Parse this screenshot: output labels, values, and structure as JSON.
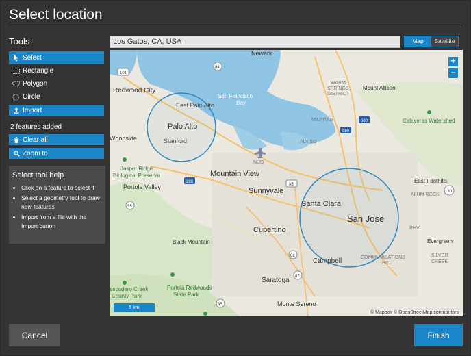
{
  "dialog": {
    "title": "Select location"
  },
  "tools": {
    "heading": "Tools",
    "items": [
      {
        "label": "Select",
        "icon": "cursor-icon",
        "active": true
      },
      {
        "label": "Rectangle",
        "icon": "rectangle-icon",
        "active": false
      },
      {
        "label": "Polygon",
        "icon": "polygon-icon",
        "active": false
      },
      {
        "label": "Circle",
        "icon": "circle-icon",
        "active": false
      }
    ],
    "import_label": "Import",
    "status": "2 features added",
    "clear_all_label": "Clear all",
    "zoom_to_label": "Zoom to"
  },
  "help": {
    "title": "Select tool help",
    "items": [
      "Click on a feature to select it",
      "Select a geometry tool to draw new features",
      "Import from a file with the Import button"
    ]
  },
  "search": {
    "value": "Los Gatos, CA, USA"
  },
  "view_toggle": {
    "map_label": "Map",
    "satellite_label": "Satellite",
    "selected": "Map"
  },
  "map": {
    "zoom_in": "+",
    "zoom_out": "−",
    "scale_label": "5 km",
    "attribution": "© Mapbox © OpenStreetMap contributors",
    "labels": {
      "newark": "Newark",
      "redwood_city": "Redwood City",
      "east_palo_alto": "East Palo Alto",
      "palo_alto": "Palo Alto",
      "stanford": "Stanford",
      "woodside": "Woodside",
      "jasper_ridge": "Jasper Ridge",
      "biological_preserve": "Biological Preserve",
      "portola_valley": "Portola Valley",
      "mountain_view": "Mountain View",
      "sunnyvale": "Sunnyvale",
      "cupertino": "Cupertino",
      "santa_clara": "Santa Clara",
      "san_jose": "San Jose",
      "campbell": "Campbell",
      "saratoga": "Saratoga",
      "monte_sereno": "Monte Sereno",
      "black_mountain": "Black Mountain",
      "portola_redwoods": "Portola Redwoods",
      "state_park": "State Park",
      "pescadero_creek": "escadero Creek",
      "county_park": "County Park",
      "san_francisco_bay": "San Francisco",
      "bay": "Bay",
      "alviso": "ALVISO",
      "nuq": "NUQ",
      "milpitas": "MILPITAS",
      "warm_springs": "WARM",
      "springs": "SPRINGS",
      "district": "DISTRICT",
      "mount_allison": "Mount Allison",
      "calaveras": "Calaveras Watershed",
      "east_foothills": "East Foothills",
      "alum_rock": "ALUM ROCK",
      "rhv": "RHV",
      "evergreen": "Evergreen",
      "silver_creek": "SILVER",
      "creek": "CREEK",
      "communications": "COMMUNICATIONS",
      "hill": "HILL",
      "shields": [
        "101",
        "84",
        "880",
        "680",
        "280",
        "85",
        "35",
        "82",
        "87",
        "130",
        "35"
      ]
    }
  },
  "footer": {
    "cancel_label": "Cancel",
    "finish_label": "Finish"
  }
}
